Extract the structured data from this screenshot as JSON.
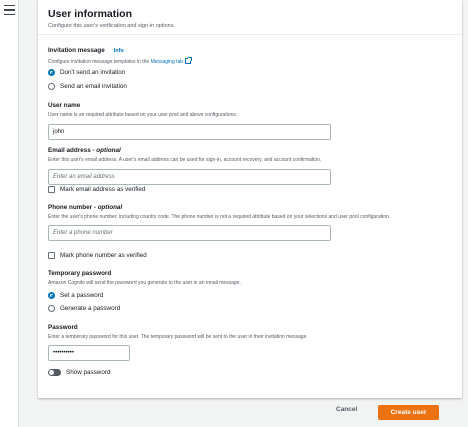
{
  "header": {
    "title": "User information",
    "description": "Configure this user's verification and sign-in options."
  },
  "invitation": {
    "label": "Invitation message",
    "info_link": "Info",
    "description_prefix": "Configure invitation message templates in the ",
    "messaging_link": "Messaging tab",
    "options": [
      {
        "label": "Don't send an invitation",
        "selected": true
      },
      {
        "label": "Send an email invitation",
        "selected": false
      }
    ]
  },
  "username": {
    "label": "User name",
    "description": "User name is an required attribute based on your user pool and above configurations.",
    "value": "john"
  },
  "email": {
    "label": "Email address - ",
    "optional": "optional",
    "description": "Enter this user's email address. A user's email address can be used for sign-in, account recovery, and account confirmation.",
    "placeholder": "Enter an email address",
    "verify_label": "Mark email address as verified",
    "verified": false
  },
  "phone": {
    "label": "Phone number - ",
    "optional": "optional",
    "description": "Enter the user's phone number, including country code. The phone number is not a required attribute based on your selections and user pool configuration.",
    "placeholder": "Enter a phone number",
    "verify_label": "Mark phone number as verified",
    "verified": false
  },
  "temp_password": {
    "label": "Temporary password",
    "description": "Amazon Cognito will send the password you generate to the user in an email message.",
    "options": [
      {
        "label": "Set a password",
        "selected": true
      },
      {
        "label": "Generate a password",
        "selected": false
      }
    ]
  },
  "password": {
    "label": "Password",
    "description": "Enter a temporary password for this user. The temporary password will be sent to the user in their invitation message.",
    "value": "••••••••••",
    "show_label": "Show password",
    "show": false
  },
  "footer": {
    "cancel_label": "Cancel",
    "create_label": "Create user"
  },
  "colors": {
    "accent": "#0073bb",
    "primary_button": "#ec7211"
  },
  "icons": {
    "menu": "hamburger-menu-icon",
    "external": "external-link-icon"
  }
}
